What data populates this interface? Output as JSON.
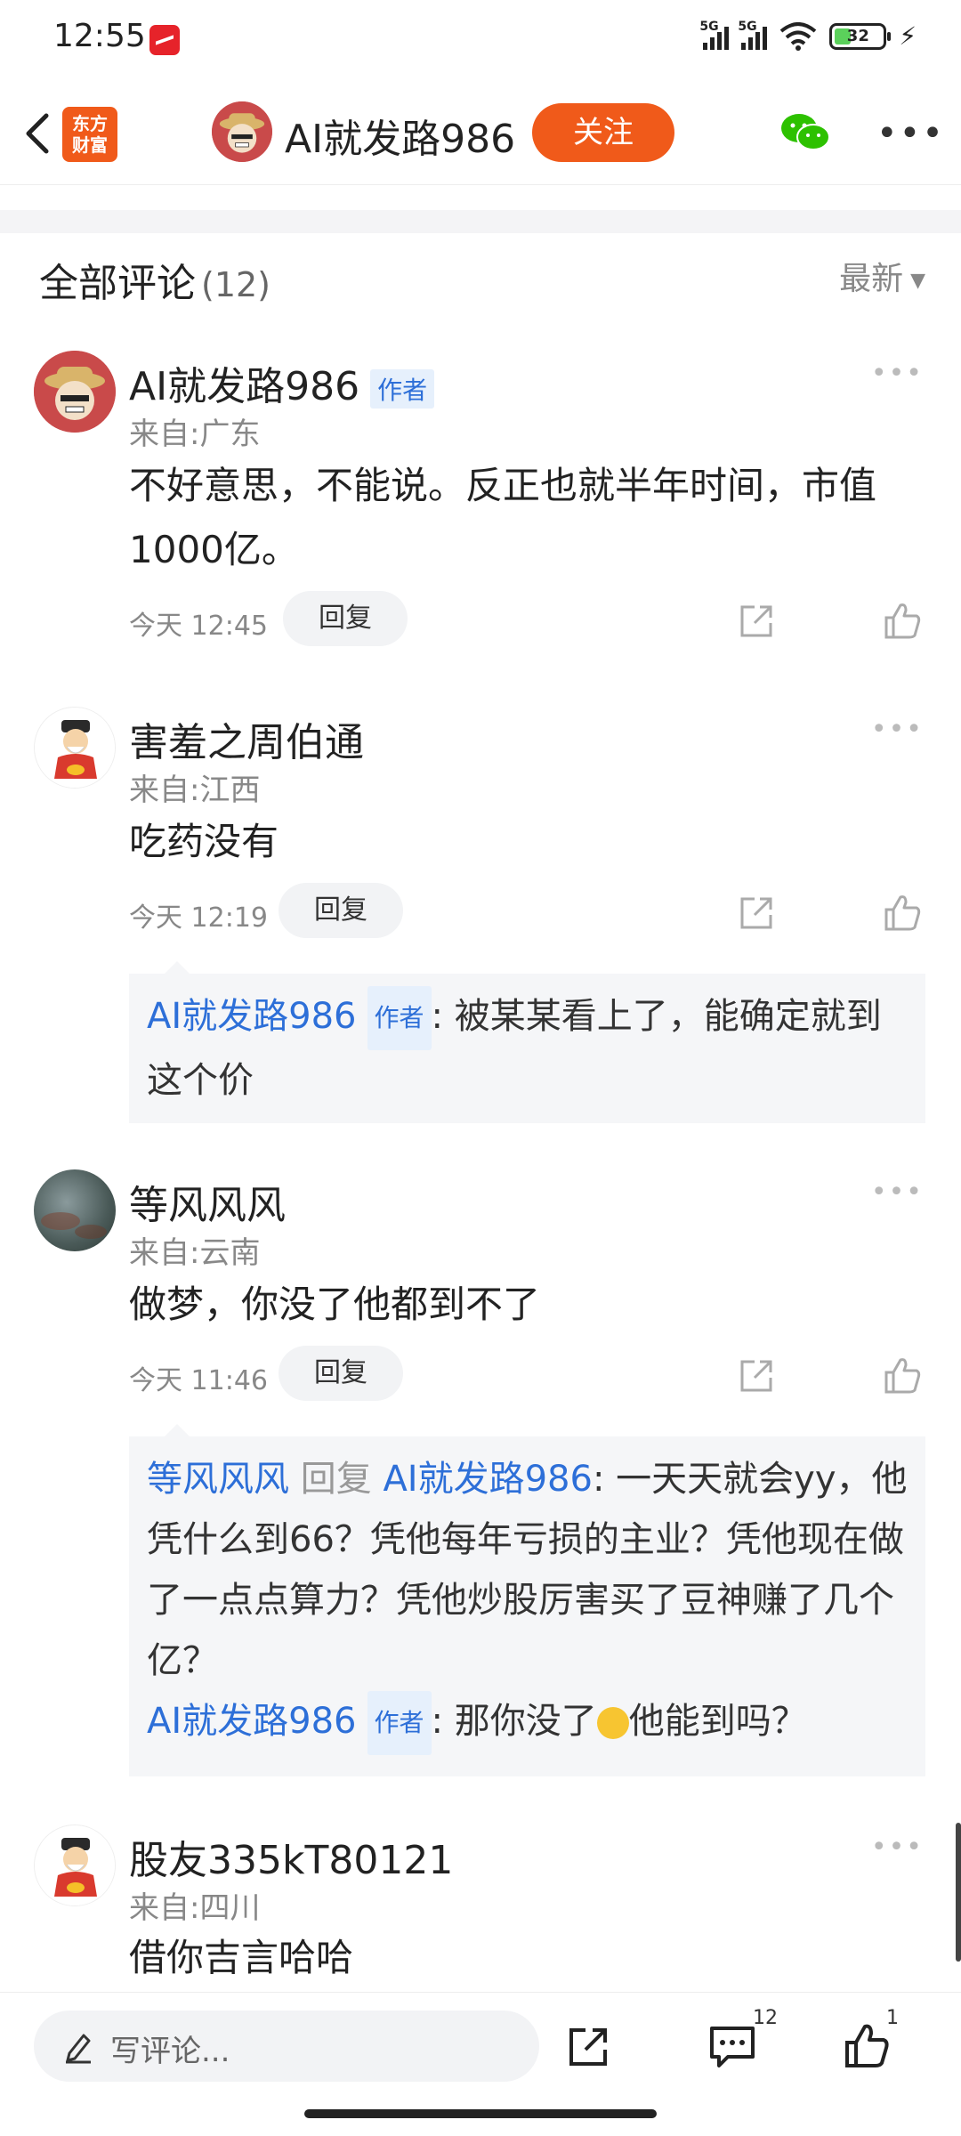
{
  "status_bar": {
    "time": "12:55",
    "signal_1": "5G",
    "signal_2": "5G",
    "battery": "32"
  },
  "header": {
    "logo_text_1": "东方",
    "logo_text_2": "财富",
    "title": "AI就发路986",
    "follow_label": "关注"
  },
  "comments_section": {
    "title": "全部评论",
    "count": "(12)",
    "sort_label": "最新"
  },
  "comments": [
    {
      "name": "AI就发路986",
      "tag": "作者",
      "location": "来自:广东",
      "text": "不好意思，不能说。反正也就半年时间，市值1000亿。",
      "time": "今天 12:45",
      "reply_label": "回复"
    },
    {
      "name": "害羞之周伯通",
      "location": "来自:江西",
      "text": "吃药没有",
      "time": "今天 12:19",
      "reply_label": "回复",
      "replies": [
        {
          "name": "AI就发路986",
          "tag": "作者",
          "text": ": 被某某看上了，能确定就到这个价"
        }
      ]
    },
    {
      "name": "等风风风",
      "location": "来自:云南",
      "text": "做梦，你没了他都到不了",
      "time": "今天 11:46",
      "reply_label": "回复",
      "replies": [
        {
          "name": "等风风风",
          "reply_word": "回复",
          "target": "AI就发路986",
          "text": ": 一天天就会yy，他凭什么到66？凭他每年亏损的主业？凭他现在做了一点点算力？凭他炒股厉害买了豆神赚了几个亿？"
        },
        {
          "name": "AI就发路986",
          "tag": "作者",
          "text_before": ": 那你没了",
          "text_after": "他能到吗？"
        }
      ]
    },
    {
      "name": "股友335kT80121",
      "location": "来自:四川",
      "text": "借你吉言哈哈"
    }
  ],
  "bottom_bar": {
    "input_placeholder": "写评论...",
    "comment_count": "12",
    "like_count": "1"
  },
  "icons": [
    "back-icon",
    "wechat-icon",
    "more-icon",
    "share-icon",
    "like-icon",
    "pen-icon",
    "comment-icon",
    "laugh-emoji-icon"
  ]
}
